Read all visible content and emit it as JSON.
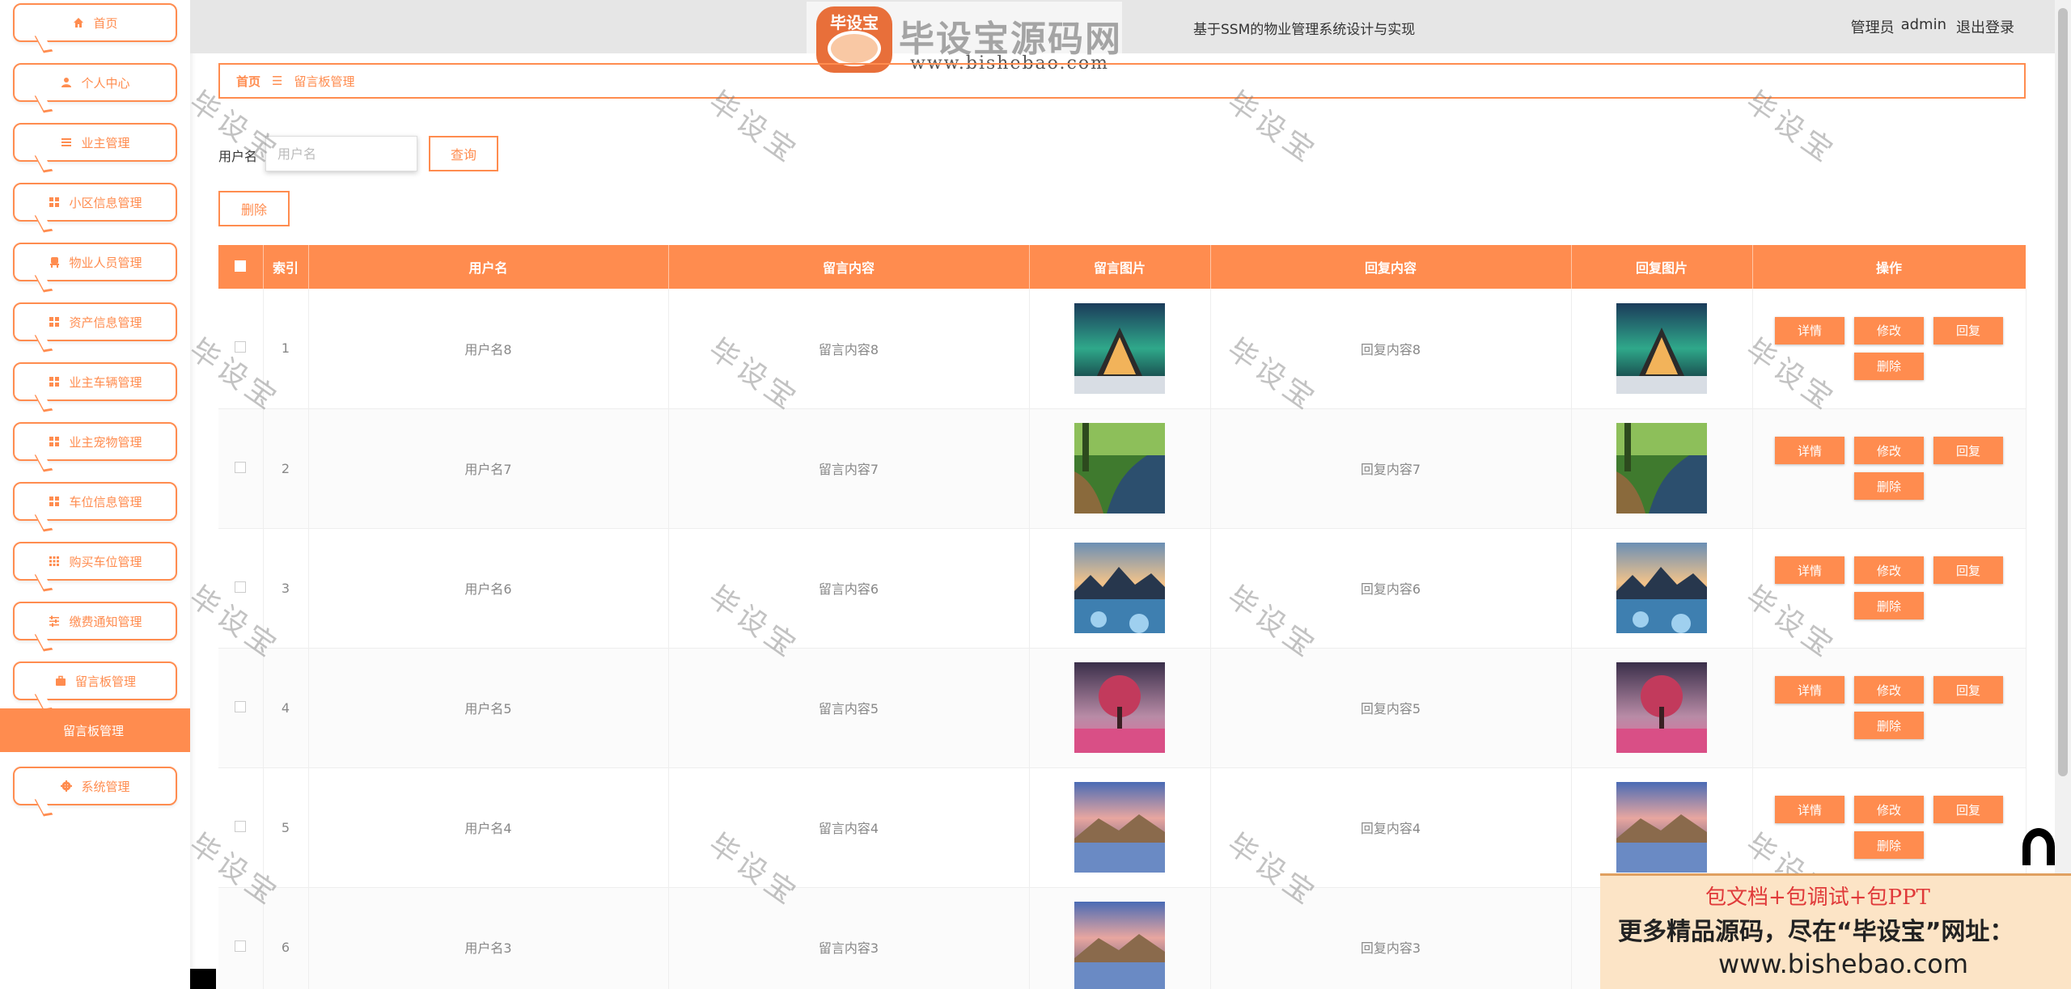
{
  "header": {
    "title": "基于SSM的物业管理系统设计与实现",
    "user_role": "管理员",
    "user_name": "admin",
    "logout": "退出登录"
  },
  "logo": {
    "seal_text": "毕设宝",
    "brand": "毕设宝源码网",
    "url": "www.bishebao.com"
  },
  "sidebar": {
    "items": [
      {
        "label": "首页",
        "icon": "home-icon"
      },
      {
        "label": "个人中心",
        "icon": "user-icon"
      },
      {
        "label": "业主管理",
        "icon": "list-icon"
      },
      {
        "label": "小区信息管理",
        "icon": "grid-icon"
      },
      {
        "label": "物业人员管理",
        "icon": "chair-icon"
      },
      {
        "label": "资产信息管理",
        "icon": "grid-icon"
      },
      {
        "label": "业主车辆管理",
        "icon": "grid-icon"
      },
      {
        "label": "业主宠物管理",
        "icon": "grid-icon"
      },
      {
        "label": "车位信息管理",
        "icon": "grid-icon"
      },
      {
        "label": "购买车位管理",
        "icon": "apps-icon"
      },
      {
        "label": "缴费通知管理",
        "icon": "sliders-icon"
      },
      {
        "label": "留言板管理",
        "icon": "briefcase-icon"
      },
      {
        "label": "系统管理",
        "icon": "settings-icon"
      }
    ],
    "active_sub": "留言板管理"
  },
  "breadcrumb": {
    "home": "首页",
    "separator": "☰",
    "current": "留言板管理"
  },
  "search": {
    "label": "用户名",
    "placeholder": "用户名",
    "button": "查询"
  },
  "toolbar": {
    "delete": "删除"
  },
  "table": {
    "columns": [
      "",
      "索引",
      "用户名",
      "留言内容",
      "留言图片",
      "回复内容",
      "回复图片",
      "操作"
    ],
    "rows": [
      {
        "index": "1",
        "username": "用户名8",
        "content": "留言内容8",
        "reply": "回复内容8",
        "image": "aurora-cabin"
      },
      {
        "index": "2",
        "username": "用户名7",
        "content": "留言内容7",
        "reply": "回复内容7",
        "image": "forest-river"
      },
      {
        "index": "3",
        "username": "用户名6",
        "content": "留言内容6",
        "reply": "回复内容6",
        "image": "mountain-lake"
      },
      {
        "index": "4",
        "username": "用户名5",
        "content": "留言内容5",
        "reply": "回复内容5",
        "image": "pink-tree"
      },
      {
        "index": "5",
        "username": "用户名4",
        "content": "留言内容4",
        "reply": "回复内容4",
        "image": "sunset-mountain"
      },
      {
        "index": "6",
        "username": "用户名3",
        "content": "留言内容3",
        "reply": "回复内容3",
        "image": "sunset-mountain"
      }
    ],
    "ops": {
      "detail": "详情",
      "edit": "修改",
      "reply": "回复",
      "delete": "删除"
    }
  },
  "watermark": "毕设宝",
  "promo": {
    "line1": "包文档+包调试+包PPT",
    "line2": "更多精品源码，尽在“毕设宝”网址：",
    "line3": "www.bishebao.com"
  },
  "colors": {
    "accent": "#ff8c4f",
    "header_bg": "#e6e6e6"
  }
}
